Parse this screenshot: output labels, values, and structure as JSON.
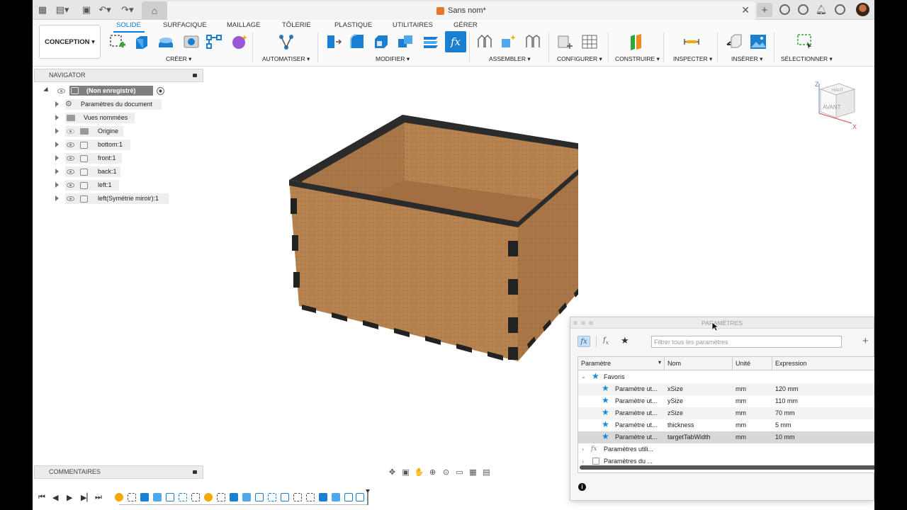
{
  "titlebar": {
    "doc_title": "Sans nom*"
  },
  "ribbon": {
    "workspace": "CONCEPTION",
    "tabs": [
      "SOLIDE",
      "SURFACIQUE",
      "MAILLAGE",
      "TÔLERIE",
      "PLASTIQUE",
      "UTILITAIRES",
      "GÉRER"
    ],
    "groups": [
      "CRÉER",
      "AUTOMATISER",
      "MODIFIER",
      "ASSEMBLER",
      "CONFIGURER",
      "CONSTRUIRE",
      "INSPECTER",
      "INSÉRER",
      "SÉLECTIONNER"
    ]
  },
  "navigator": {
    "title": "NAVIGATOR",
    "root": "(Non enregistré)",
    "items": [
      {
        "label": "Paramètres du document"
      },
      {
        "label": "Vues nommées"
      },
      {
        "label": "Origine"
      },
      {
        "label": "bottom:1"
      },
      {
        "label": "front:1"
      },
      {
        "label": "back:1"
      },
      {
        "label": "left:1"
      },
      {
        "label": "left(Symétrie miroir):1"
      }
    ]
  },
  "comments": {
    "title": "COMMENTAIRES"
  },
  "viewcube": {
    "top": "HAUT",
    "front": "AVANT",
    "axis_z": "Z",
    "axis_x": "X"
  },
  "parameters": {
    "title": "PARAMÈTRES",
    "filter_placeholder": "Filtrer tous les paramètres",
    "columns": [
      "Paramètre",
      "Nom",
      "Unité",
      "Expression"
    ],
    "favorites_label": "Favoris",
    "rows": [
      {
        "param": "Paramètre ut...",
        "name": "xSize",
        "unit": "mm",
        "expr": "120 mm"
      },
      {
        "param": "Paramètre ut...",
        "name": "ySize",
        "unit": "mm",
        "expr": "110 mm"
      },
      {
        "param": "Paramètre ut...",
        "name": "zSize",
        "unit": "mm",
        "expr": "70 mm"
      },
      {
        "param": "Paramètre ut...",
        "name": "thickness",
        "unit": "mm",
        "expr": "5 mm"
      },
      {
        "param": "Paramètre ut...",
        "name": "targetTabWidth",
        "unit": "mm",
        "expr": "10 mm"
      }
    ],
    "group_user": "Paramètres utili...",
    "group_model": "Paramètres du ..."
  }
}
